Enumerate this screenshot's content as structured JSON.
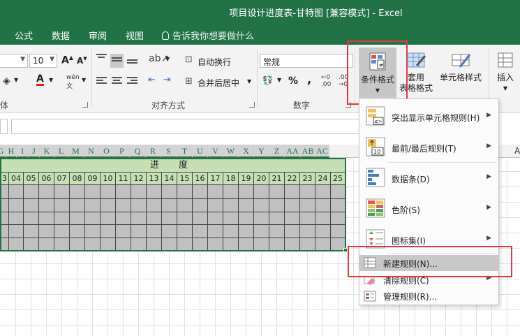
{
  "window": {
    "title": "项目设计进度表-甘特图  [兼容模式]  -  Excel"
  },
  "tabs": [
    "公式",
    "数据",
    "审阅",
    "视图"
  ],
  "tell_me": "告诉我你想要做什么",
  "ribbon": {
    "font_size": "10",
    "alignment": {
      "wrap_text": "自动换行",
      "merge_center": "合并后居中",
      "group_label": "对齐方式"
    },
    "number": {
      "format": "常规",
      "percent": "%",
      "comma": ",",
      "group_label": "数字"
    },
    "font_group_tail": "体",
    "phonetic": "wén",
    "styles": {
      "conditional_formatting": "条件格式",
      "format_as_table_1": "套用",
      "format_as_table_2": "表格格式",
      "cell_styles": "单元格样式"
    },
    "cells": {
      "insert": "插入"
    },
    "accent": "#217346",
    "highlight_color": "#e8383d"
  },
  "sheet": {
    "columns": [
      "G",
      "H",
      "I",
      "J",
      "K",
      "L",
      "M",
      "N",
      "O",
      "P",
      "Q",
      "R",
      "S",
      "T",
      "U",
      "V",
      "W",
      "X",
      "Y",
      "Z",
      "AA",
      "AB",
      "AC"
    ],
    "header_title": "进  度",
    "numbers": [
      "3",
      "04",
      "05",
      "06",
      "07",
      "08",
      "09",
      "10",
      "11",
      "12",
      "13",
      "14",
      "15",
      "16",
      "17",
      "18",
      "19",
      "20",
      "21",
      "22",
      "23",
      "24",
      "25"
    ],
    "right_col": "A"
  },
  "cf_menu": {
    "items": [
      {
        "label": "突出显示单元格规则(H)",
        "submenu": true
      },
      {
        "label": "最前/最后规则(T)",
        "submenu": true
      },
      {
        "label": "数据条(D)",
        "submenu": true
      },
      {
        "label": "色阶(S)",
        "submenu": true
      },
      {
        "label": "图标集(I)",
        "submenu": true
      }
    ],
    "small_items": [
      {
        "label": "新建规则(N)...",
        "hovered": true
      },
      {
        "label": "清除规则(C)",
        "submenu": true
      },
      {
        "label": "管理规则(R)..."
      }
    ],
    "icon_text_1": "10",
    "icon_text_2": "≤>"
  }
}
